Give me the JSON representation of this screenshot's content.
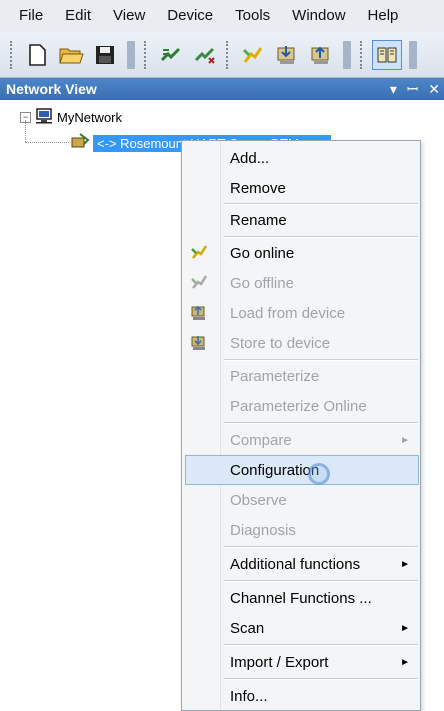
{
  "menubar": {
    "items": [
      "File",
      "Edit",
      "View",
      "Device",
      "Tools",
      "Window",
      "Help"
    ]
  },
  "toolbar": {
    "buttons": [
      "new-icon",
      "open-icon",
      "save-icon",
      "connect-icon",
      "disconnect-icon",
      "go-online-icon",
      "store-icon",
      "load-icon",
      "network-view-icon"
    ]
  },
  "panel": {
    "title": "Network View",
    "header_icons": [
      "▾",
      "ꟷ",
      "✕"
    ]
  },
  "tree": {
    "root_label": "MyNetwork",
    "root_expander": "−",
    "child_label": "<-> Rosemount HART Comm DTM"
  },
  "context_menu": {
    "items": [
      {
        "label": "Add...",
        "disabled": false
      },
      {
        "label": "Remove",
        "disabled": false
      },
      {
        "label": "Rename",
        "disabled": false
      },
      {
        "label": "Go online",
        "disabled": false,
        "icon": "go-online-icon"
      },
      {
        "label": "Go offline",
        "disabled": true,
        "icon": "go-offline-icon"
      },
      {
        "label": "Load from device",
        "disabled": true,
        "icon": "load-from-device-icon"
      },
      {
        "label": "Store to device",
        "disabled": true,
        "icon": "store-to-device-icon"
      },
      {
        "label": "Parameterize",
        "disabled": true
      },
      {
        "label": "Parameterize Online",
        "disabled": true
      },
      {
        "label": "Compare",
        "disabled": true,
        "submenu": true
      },
      {
        "label": "Configuration",
        "disabled": false,
        "highlighted": true
      },
      {
        "label": "Observe",
        "disabled": true
      },
      {
        "label": "Diagnosis",
        "disabled": true
      },
      {
        "label": "Additional functions",
        "disabled": false,
        "submenu": true
      },
      {
        "label": "Channel Functions ...",
        "disabled": false
      },
      {
        "label": "Scan",
        "disabled": false,
        "submenu": true
      },
      {
        "label": "Import / Export",
        "disabled": false,
        "submenu": true
      },
      {
        "label": "Info...",
        "disabled": false
      }
    ],
    "submenu_arrow": "►"
  },
  "colors": {
    "header_blue": "#3a6eb3",
    "selection_blue": "#3399ff",
    "highlight_bg": "#dbe8f8",
    "disabled_text": "#a0a4aa"
  }
}
